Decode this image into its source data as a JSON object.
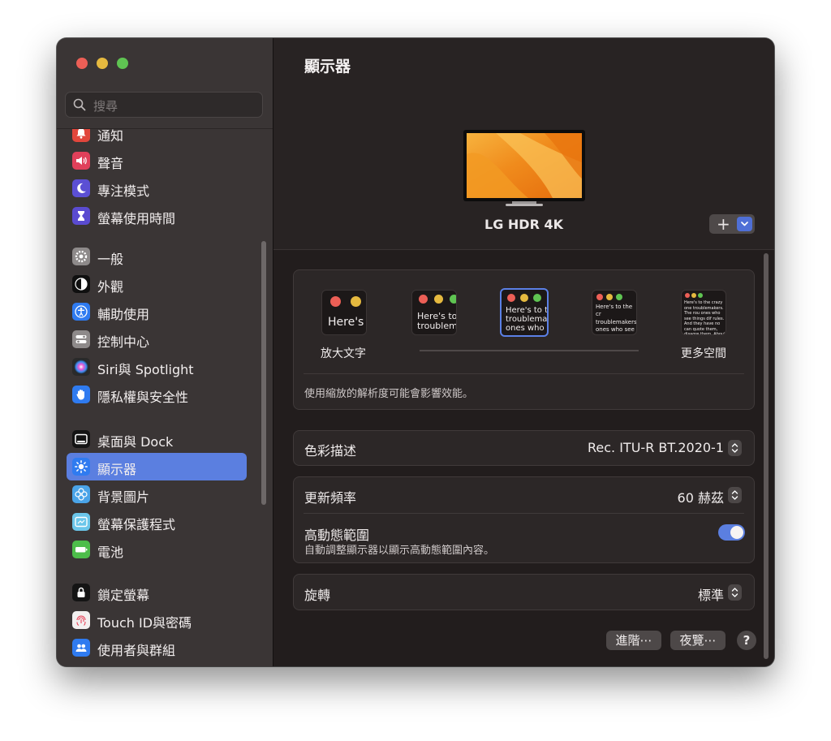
{
  "search": {
    "placeholder": "搜尋"
  },
  "sidebar": {
    "items": [
      {
        "label": "通知",
        "icon": "bell-icon",
        "color": "#e1463c"
      },
      {
        "label": "聲音",
        "icon": "speaker-icon",
        "color": "#e0405a"
      },
      {
        "label": "專注模式",
        "icon": "moon-icon",
        "color": "#5b4fd4"
      },
      {
        "label": "螢幕使用時間",
        "icon": "hourglass-icon",
        "color": "#5a4bd0"
      },
      {
        "label": "一般",
        "icon": "gear-icon",
        "color": "#8e8a8a"
      },
      {
        "label": "外觀",
        "icon": "appearance-icon",
        "color": "#101010"
      },
      {
        "label": "輔助使用",
        "icon": "accessibility-icon",
        "color": "#2f7bf0"
      },
      {
        "label": "控制中心",
        "icon": "control-center-icon",
        "color": "#8e8a8a"
      },
      {
        "label": "Siri與 Spotlight",
        "icon": "siri-icon",
        "color": "#2a2a2a"
      },
      {
        "label": "隱私權與安全性",
        "icon": "hand-icon",
        "color": "#2f7bf0"
      },
      {
        "label": "桌面與 Dock",
        "icon": "dock-icon",
        "color": "#141414"
      },
      {
        "label": "顯示器",
        "icon": "brightness-icon",
        "color": "#2f7bf0"
      },
      {
        "label": "背景圖片",
        "icon": "wallpaper-icon",
        "color": "#4aa4e8"
      },
      {
        "label": "螢幕保護程式",
        "icon": "screensaver-icon",
        "color": "#6bc6ea"
      },
      {
        "label": "電池",
        "icon": "battery-icon",
        "color": "#4dbd4a"
      },
      {
        "label": "鎖定螢幕",
        "icon": "lock-icon",
        "color": "#141414"
      },
      {
        "label": "Touch ID與密碼",
        "icon": "fingerprint-icon",
        "color": "#f2f0f0"
      },
      {
        "label": "使用者與群組",
        "icon": "users-icon",
        "color": "#2f7bf0"
      }
    ]
  },
  "main": {
    "title": "顯示器",
    "monitor_name": "LG HDR 4K",
    "add_symbol": "+",
    "resolution": {
      "thumbs": [
        {
          "text": "Here's"
        },
        {
          "text": "Here's to troublem"
        },
        {
          "text": "Here's to t troublema ones who"
        },
        {
          "text": "Here's to the cr troublemakers. ones who see t rules. And they"
        },
        {
          "text": "Here's to the crazy one troublemakers. The rou ones who see things dif rules. And they have no can quote them, disagre them. About the only th Because they change th"
        }
      ],
      "label_left": "放大文字",
      "label_right": "更多空間",
      "note": "使用縮放的解析度可能會影響效能。"
    },
    "color_profile": {
      "label": "色彩描述",
      "value": "Rec. ITU-R BT.2020-1"
    },
    "refresh_rate": {
      "label": "更新頻率",
      "value": "60 赫茲"
    },
    "hdr": {
      "label": "高動態範圍",
      "sub": "自動調整顯示器以顯示高動態範圍內容。",
      "enabled": true
    },
    "rotation": {
      "label": "旋轉",
      "value": "標準"
    },
    "buttons": {
      "advanced": "進階⋯",
      "night_shift": "夜覽⋯",
      "help": "?"
    }
  },
  "colors": {
    "accent": "#5b7fe0",
    "sidebar_bg": "#3a3535",
    "main_bg": "#221d1d"
  }
}
